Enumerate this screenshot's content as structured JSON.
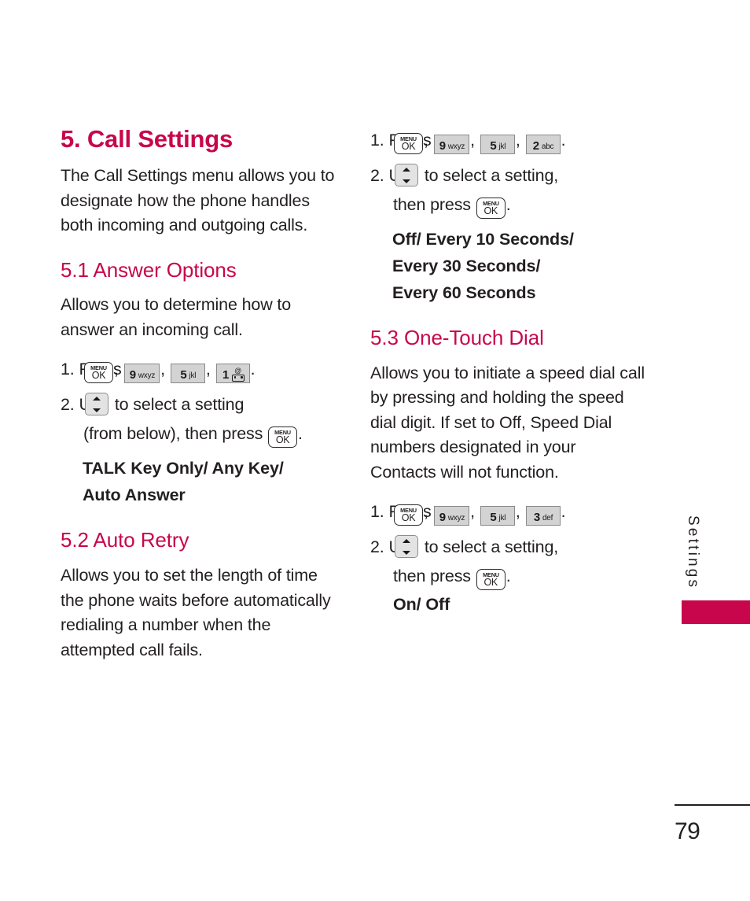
{
  "document": {
    "page_number": "79",
    "side_tab_label": "Settings",
    "accent_color": "#c8064b",
    "text_color": "#231f20"
  },
  "keys": {
    "menu_ok": {
      "top": "MENU",
      "bottom": "OK",
      "name": "menu-ok-key"
    },
    "nine": {
      "digit": "9",
      "letters": "wxyz"
    },
    "five": {
      "digit": "5",
      "letters": "jkl"
    },
    "one": {
      "digit": "1",
      "letters": "@"
    },
    "two": {
      "digit": "2",
      "letters": "abc"
    },
    "three": {
      "digit": "3",
      "letters": "def"
    },
    "nav": {
      "name": "up-down-navigation-key"
    }
  },
  "left_column": {
    "chapter_heading": "5. Call Settings",
    "chapter_intro": "The Call Settings menu allows you to designate how the phone handles both incoming and outgoing calls.",
    "section_5_1": {
      "heading": "5.1 Answer Options",
      "body": "Allows you to determine how to answer an incoming call.",
      "step1_prefix": "1. Press",
      "step1_punct_comma": ",",
      "step1_punct_period": ".",
      "step2_prefix": "2. Use",
      "step2_mid": "to select a setting",
      "step2_line2a": "(from below), then press",
      "step2_line2_period": ".",
      "options": [
        "TALK Key Only/ Any Key/",
        "Auto Answer"
      ]
    },
    "section_5_2": {
      "heading": "5.2 Auto Retry",
      "body": "Allows you to set the length of time the phone waits before automatically redialing a number when the attempted call fails."
    }
  },
  "right_column": {
    "section_5_2_steps": {
      "step1_prefix": "1. Press",
      "step1_punct_comma": ",",
      "step1_punct_period": ".",
      "step2_prefix": "2. Use",
      "step2_mid": "to select a setting,",
      "step2_line2": "then press",
      "step2_line2_period": ".",
      "options": [
        "Off/ Every 10 Seconds/",
        "Every 30 Seconds/",
        "Every 60 Seconds"
      ]
    },
    "section_5_3": {
      "heading": "5.3 One-Touch Dial",
      "body": "Allows you to initiate a speed dial call by pressing and holding the speed dial digit. If set to Off, Speed Dial numbers designated in your Contacts will not function.",
      "step1_prefix": "1. Press",
      "step1_punct_comma": ",",
      "step1_punct_period": ".",
      "step2_prefix": "2. Use",
      "step2_mid": "to select a setting,",
      "step2_line2": "then press",
      "step2_line2_period": ".",
      "options": [
        "On/ Off"
      ]
    }
  }
}
